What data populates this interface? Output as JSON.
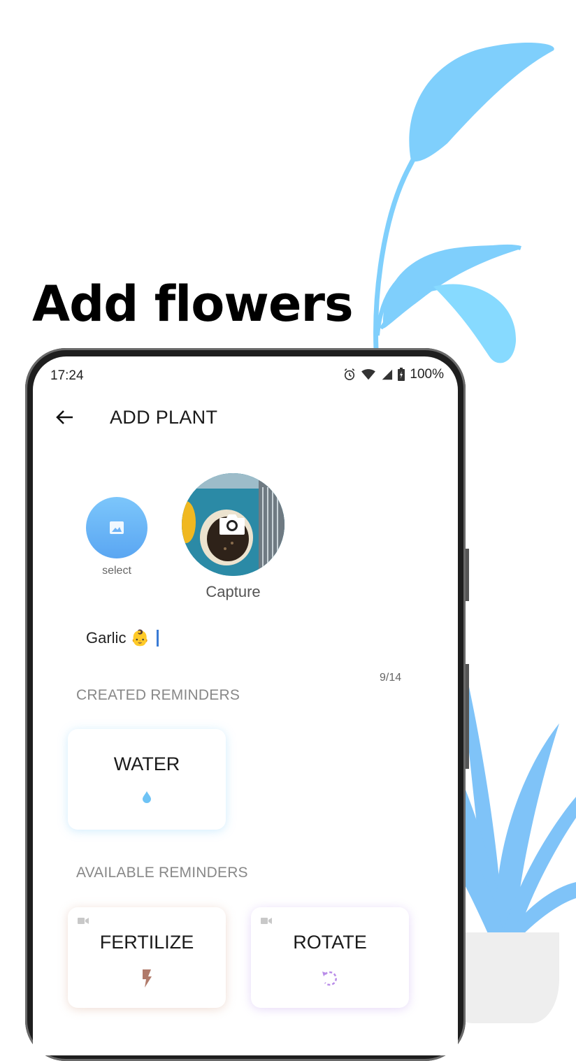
{
  "headline": "Add flowers",
  "status_bar": {
    "time": "17:24",
    "battery": "100%"
  },
  "app_bar": {
    "title": "ADD PLANT"
  },
  "photo": {
    "select_label": "select",
    "capture_label": "Capture"
  },
  "name_field": {
    "value": "Garlic 👶",
    "counter": "9/14"
  },
  "created_section": {
    "label": "CREATED REMINDERS",
    "cards": [
      {
        "label": "WATER",
        "icon": "water-drop-icon"
      }
    ]
  },
  "available_section": {
    "label": "AVAILABLE REMINDERS",
    "cards": [
      {
        "label": "FERTILIZE",
        "icon": "lightning-icon"
      },
      {
        "label": "ROTATE",
        "icon": "rotate-icon"
      }
    ]
  },
  "colors": {
    "accent": "#5aa6f2",
    "leaf": "#7fcffc",
    "drop": "#6ec3f5",
    "fertilize": "#b07a6a",
    "rotate": "#b98ce8"
  }
}
